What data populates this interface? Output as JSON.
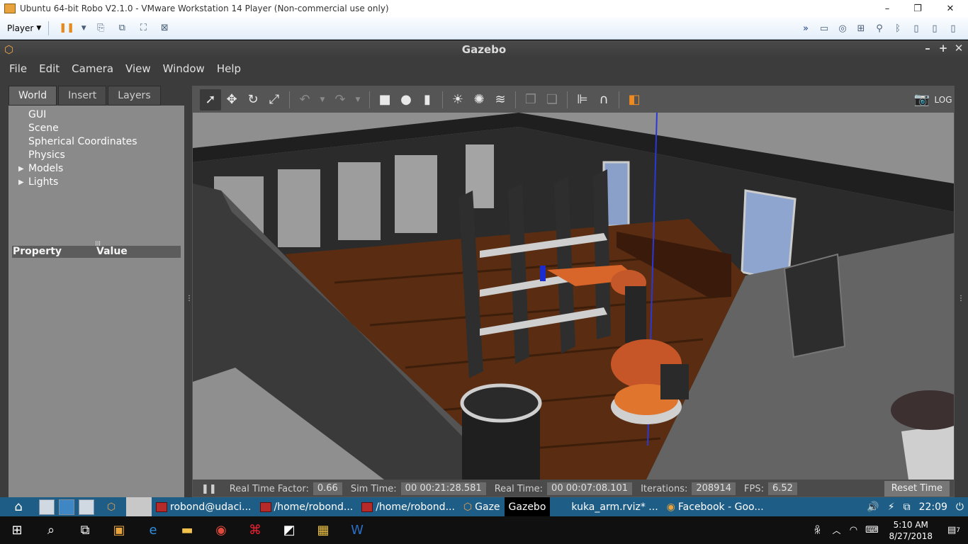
{
  "vm_window": {
    "title": "Ubuntu 64-bit Robo V2.1.0 - VMware Workstation 14 Player (Non-commercial use only)",
    "menu_label": "Player",
    "minimize": "–",
    "restore": "❐",
    "close": "✕"
  },
  "gazebo": {
    "title": "Gazebo",
    "menu": [
      "File",
      "Edit",
      "Camera",
      "View",
      "Window",
      "Help"
    ],
    "window_controls": [
      "–",
      "+",
      "✕"
    ]
  },
  "left_panel": {
    "tabs": [
      "World",
      "Insert",
      "Layers"
    ],
    "active_tab": "World",
    "tree": [
      {
        "label": "GUI",
        "expandable": false
      },
      {
        "label": "Scene",
        "expandable": false
      },
      {
        "label": "Spherical Coordinates",
        "expandable": false
      },
      {
        "label": "Physics",
        "expandable": false
      },
      {
        "label": "Models",
        "expandable": true
      },
      {
        "label": "Lights",
        "expandable": true
      }
    ],
    "property_header": "Property",
    "value_header": "Value"
  },
  "status_bar": {
    "real_time_factor_label": "Real Time Factor:",
    "real_time_factor": "0.66",
    "sim_time_label": "Sim Time:",
    "sim_time": "00 00:21:28.581",
    "real_time_label": "Real Time:",
    "real_time": "00 00:07:08.101",
    "iterations_label": "Iterations:",
    "iterations": "208914",
    "fps_label": "FPS:",
    "fps": "6.52",
    "reset_label": "Reset Time"
  },
  "ubuntu_taskbar": {
    "items": [
      {
        "label": "robond@udaci...",
        "active": false
      },
      {
        "label": "/home/robond...",
        "active": false
      },
      {
        "label": "/home/robond...",
        "active": false
      },
      {
        "label": "Gaze",
        "active": false
      },
      {
        "label": "Gazebo",
        "active": true
      },
      {
        "label": "kuka_arm.rviz* ...",
        "active": false
      },
      {
        "label": "Facebook - Goo...",
        "active": false
      }
    ],
    "time": "22:09"
  },
  "windows_taskbar": {
    "time": "5:10 AM",
    "date": "8/27/2018",
    "notification_count": "7"
  },
  "colors": {
    "gazebo_bg": "#3c3c3c",
    "panel_bg": "#8a8a8a",
    "floor": "#5a2d12",
    "accent_orange": "#e87a2a",
    "ubuntu_bar": "#1d5d86"
  }
}
